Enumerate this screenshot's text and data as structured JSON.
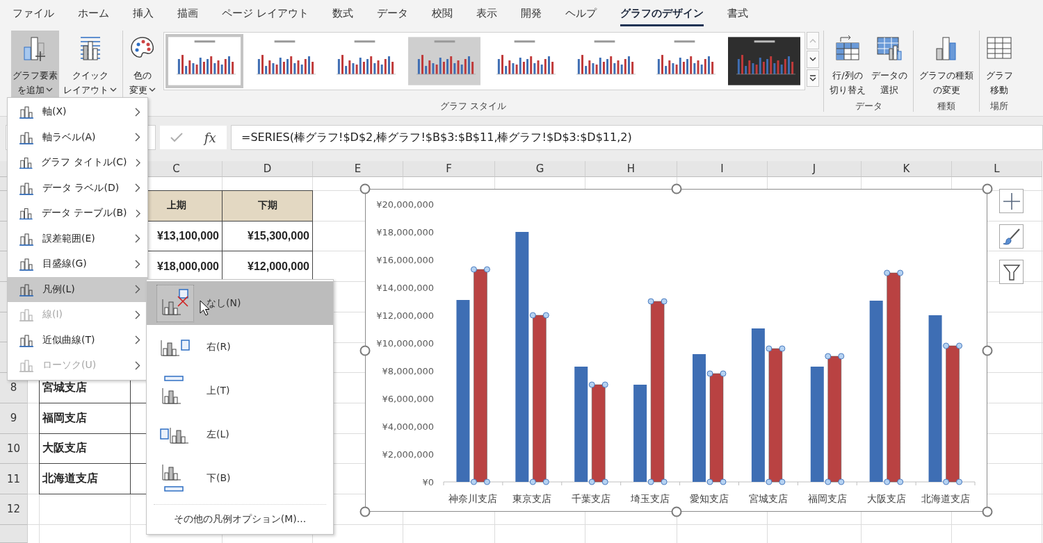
{
  "tabs": [
    {
      "label": "ファイル",
      "selected": false
    },
    {
      "label": "ホーム",
      "selected": false
    },
    {
      "label": "挿入",
      "selected": false
    },
    {
      "label": "描画",
      "selected": false
    },
    {
      "label": "ページ レイアウト",
      "selected": false
    },
    {
      "label": "数式",
      "selected": false
    },
    {
      "label": "データ",
      "selected": false
    },
    {
      "label": "校閲",
      "selected": false
    },
    {
      "label": "表示",
      "selected": false
    },
    {
      "label": "開発",
      "selected": false
    },
    {
      "label": "ヘルプ",
      "selected": false
    },
    {
      "label": "グラフのデザイン",
      "selected": true
    },
    {
      "label": "書式",
      "selected": false
    }
  ],
  "ribbon": {
    "groups": [
      {
        "buttons": [
          {
            "kind": "add-element",
            "lines": [
              "グラフ要素",
              "を追加"
            ],
            "dropdown": true,
            "pressed": true
          },
          {
            "kind": "quick-layout",
            "lines": [
              "クイック",
              "レイアウト"
            ],
            "dropdown": true,
            "pressed": false
          }
        ]
      },
      {
        "label": "グラフ スタイル",
        "buttons": [
          {
            "kind": "colors",
            "lines": [
              "色の",
              "変更"
            ],
            "dropdown": true,
            "pressed": false
          }
        ],
        "gallery": {
          "thumbnails": [
            {
              "kind": "light",
              "selected": true
            },
            {
              "kind": "light",
              "selected": false
            },
            {
              "kind": "light",
              "selected": false
            },
            {
              "kind": "gray",
              "selected": false
            },
            {
              "kind": "light",
              "selected": false
            },
            {
              "kind": "light",
              "selected": false
            },
            {
              "kind": "light",
              "selected": false
            },
            {
              "kind": "dark",
              "selected": false
            }
          ]
        }
      },
      {
        "label": "データ",
        "buttons": [
          {
            "kind": "switch",
            "lines": [
              "行/列の",
              "切り替え"
            ],
            "dropdown": false,
            "pressed": false
          },
          {
            "kind": "select-data",
            "lines": [
              "データの",
              "選択"
            ],
            "dropdown": false,
            "pressed": false
          }
        ]
      },
      {
        "label": "種類",
        "buttons": [
          {
            "kind": "change-type",
            "lines": [
              "グラフの種類",
              "の変更"
            ],
            "dropdown": false,
            "pressed": false
          }
        ]
      },
      {
        "label": "場所",
        "buttons": [
          {
            "kind": "move",
            "lines": [
              "グラフ",
              "移動"
            ],
            "dropdown": false,
            "pressed": false
          }
        ]
      }
    ]
  },
  "formula_bar": {
    "function_label": "fx",
    "formula": "=SERIES(棒グラフ!$D$2,棒グラフ!$B$3:$B$11,棒グラフ!$D$3:$D$11,2)"
  },
  "sheet": {
    "columns": [
      "C",
      "D",
      "E",
      "F",
      "G",
      "H",
      "I",
      "J",
      "K",
      "L"
    ],
    "rows": [
      {
        "kind": "blank"
      },
      {
        "kind": "header",
        "column_c": "上期",
        "column_d": "下期"
      },
      {
        "kind": "data",
        "column_c": "¥13,100,000",
        "column_d": "¥15,300,000"
      },
      {
        "kind": "data",
        "column_c": "¥18,000,000",
        "column_d": "¥12,000,000"
      },
      {
        "kind": "data"
      },
      {
        "kind": "data"
      },
      {
        "kind": "data"
      },
      {
        "kind": "data",
        "number": "8",
        "column_b": "宮城支店"
      },
      {
        "kind": "data",
        "number": "9",
        "column_b": "福岡支店"
      },
      {
        "kind": "data",
        "number": "10",
        "column_b": "大阪支店"
      },
      {
        "kind": "data",
        "number": "11",
        "column_b": "北海道支店"
      },
      {
        "kind": "blank",
        "number": "12"
      }
    ]
  },
  "chart": {
    "series_states": [
      {
        "selected": false
      },
      {
        "selected": true
      }
    ],
    "tools": [
      {
        "kind": "add"
      },
      {
        "kind": "style"
      },
      {
        "kind": "filter"
      }
    ],
    "chart_data": {
      "type": "bar",
      "categories": [
        "神奈川支店",
        "東京支店",
        "千葉支店",
        "埼玉支店",
        "愛知支店",
        "宮城支店",
        "福岡支店",
        "大阪支店",
        "北海道支店"
      ],
      "series": [
        {
          "color": "#3e6eb4",
          "values": [
            13100000,
            18000000,
            8300000,
            7000000,
            9200000,
            11050000,
            8300000,
            13050000,
            12000000
          ]
        },
        {
          "color": "#b94242",
          "values": [
            15300000,
            12000000,
            7000000,
            13000000,
            7800000,
            9600000,
            9050000,
            15050000,
            9800000
          ]
        }
      ],
      "ylim": [
        0,
        20000000
      ],
      "yticks": [
        {
          "value": 0,
          "label": "¥0"
        },
        {
          "value": 2000000,
          "label": "¥2,000,000"
        },
        {
          "value": 4000000,
          "label": "¥4,000,000"
        },
        {
          "value": 6000000,
          "label": "¥6,000,000"
        },
        {
          "value": 8000000,
          "label": "¥8,000,000"
        },
        {
          "value": 10000000,
          "label": "¥10,000,000"
        },
        {
          "value": 12000000,
          "label": "¥12,000,000"
        },
        {
          "value": 14000000,
          "label": "¥14,000,000"
        },
        {
          "value": 16000000,
          "label": "¥16,000,000"
        },
        {
          "value": 18000000,
          "label": "¥18,000,000"
        },
        {
          "value": 20000000,
          "label": "¥20,000,000"
        }
      ]
    }
  },
  "menu": {
    "items": [
      {
        "label": "軸(X)",
        "selected": false,
        "disabled": false
      },
      {
        "label": "軸ラベル(A)",
        "selected": false,
        "disabled": false
      },
      {
        "label": "グラフ タイトル(C)",
        "selected": false,
        "disabled": false
      },
      {
        "label": "データ ラベル(D)",
        "selected": false,
        "disabled": false
      },
      {
        "label": "データ テーブル(B)",
        "selected": false,
        "disabled": false
      },
      {
        "label": "誤差範囲(E)",
        "selected": false,
        "disabled": false
      },
      {
        "label": "目盛線(G)",
        "selected": false,
        "disabled": false
      },
      {
        "label": "凡例(L)",
        "selected": true,
        "disabled": false
      },
      {
        "label": "線(I)",
        "selected": false,
        "disabled": true
      },
      {
        "label": "近似曲線(T)",
        "selected": false,
        "disabled": false
      },
      {
        "label": "ローソク(U)",
        "selected": false,
        "disabled": true
      }
    ]
  },
  "submenu": {
    "items": [
      {
        "kind": "none",
        "label": "なし(N)",
        "selected": true
      },
      {
        "kind": "right",
        "label": "右(R)",
        "selected": false
      },
      {
        "kind": "top",
        "label": "上(T)",
        "selected": false
      },
      {
        "kind": "left",
        "label": "左(L)",
        "selected": false
      },
      {
        "kind": "bottom",
        "label": "下(B)",
        "selected": false
      }
    ],
    "footer": "その他の凡例オプション(M)..."
  }
}
